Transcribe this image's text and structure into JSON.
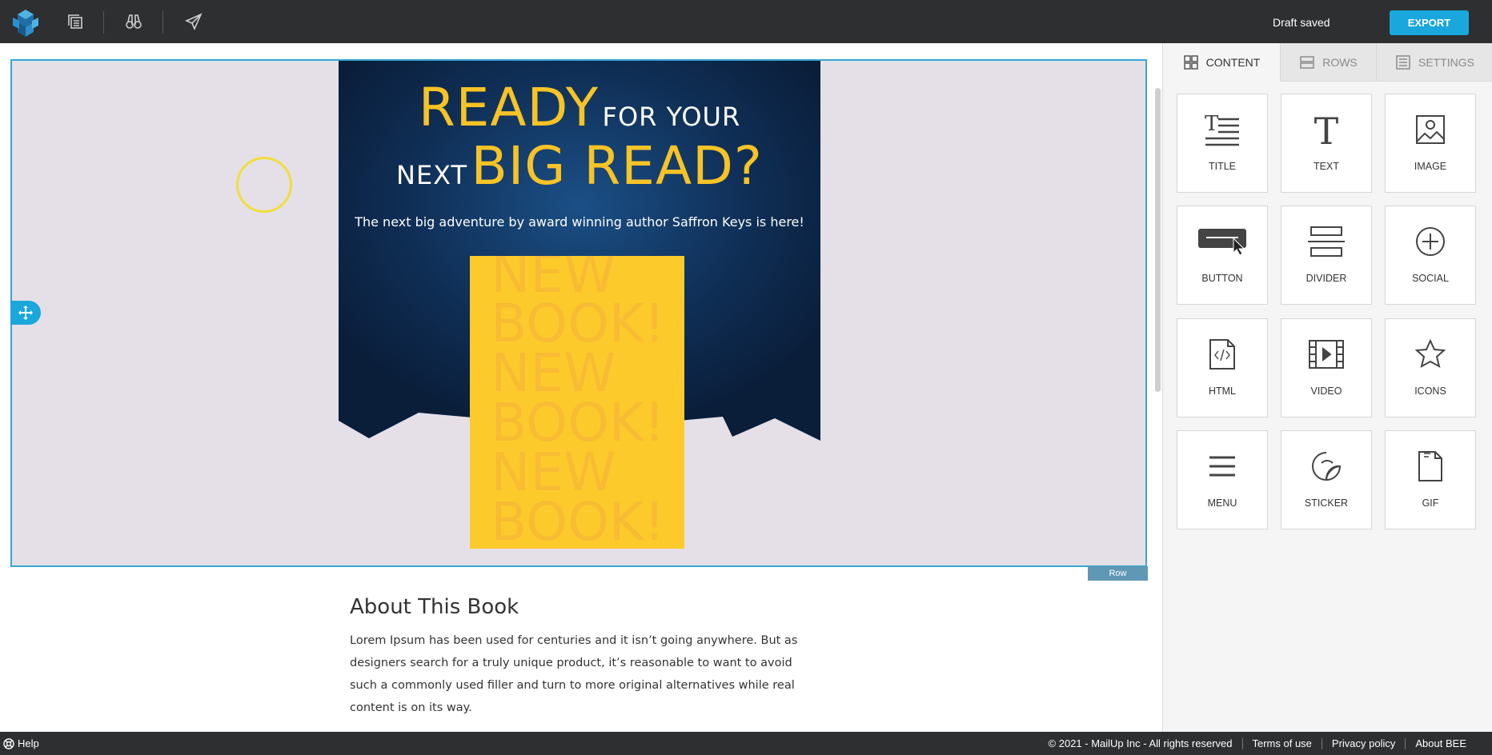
{
  "toolbar": {
    "draft_status": "Draft saved",
    "export_label": "EXPORT"
  },
  "hero": {
    "line1_big": "READY",
    "line1_small": "FOR YOUR",
    "line2_small": "NEXT",
    "line2_big": "BIG READ?",
    "subtitle": "The next big adventure by award winning author Saffron Keys is here!",
    "book_lines": [
      "NEW",
      "BOOK!",
      "NEW",
      "BOOK!",
      "NEW",
      "BOOK!"
    ]
  },
  "row_tag": "Row",
  "about": {
    "title": "About This Book",
    "body": "Lorem Ipsum has been used for centuries and it isn’t going anywhere. But as designers search for a truly unique product, it’s reasonable to want to avoid such a commonly used filler and turn to more original alternatives while real content is on its way."
  },
  "panel": {
    "tabs": [
      {
        "label": "CONTENT",
        "icon": "grid-icon"
      },
      {
        "label": "ROWS",
        "icon": "rows-icon"
      },
      {
        "label": "SETTINGS",
        "icon": "settings-icon"
      }
    ],
    "blocks": [
      {
        "label": "TITLE",
        "icon": "title-icon"
      },
      {
        "label": "TEXT",
        "icon": "text-icon"
      },
      {
        "label": "IMAGE",
        "icon": "image-icon"
      },
      {
        "label": "BUTTON",
        "icon": "button-icon"
      },
      {
        "label": "DIVIDER",
        "icon": "divider-icon"
      },
      {
        "label": "SOCIAL",
        "icon": "social-icon"
      },
      {
        "label": "HTML",
        "icon": "html-icon"
      },
      {
        "label": "VIDEO",
        "icon": "video-icon"
      },
      {
        "label": "ICONS",
        "icon": "star-icon"
      },
      {
        "label": "MENU",
        "icon": "menu-icon"
      },
      {
        "label": "STICKER",
        "icon": "sticker-icon"
      },
      {
        "label": "GIF",
        "icon": "gif-icon"
      }
    ]
  },
  "footer": {
    "help": "Help",
    "copyright": "© 2021 - MailUp Inc - All rights reserved",
    "terms": "Terms of use",
    "privacy": "Privacy policy",
    "about": "About BEE"
  },
  "colors": {
    "accent": "#1aa7dc",
    "topbar": "#2d2f30",
    "hero_yellow": "#f7c325",
    "hero_navy": "#0f2a4a"
  }
}
